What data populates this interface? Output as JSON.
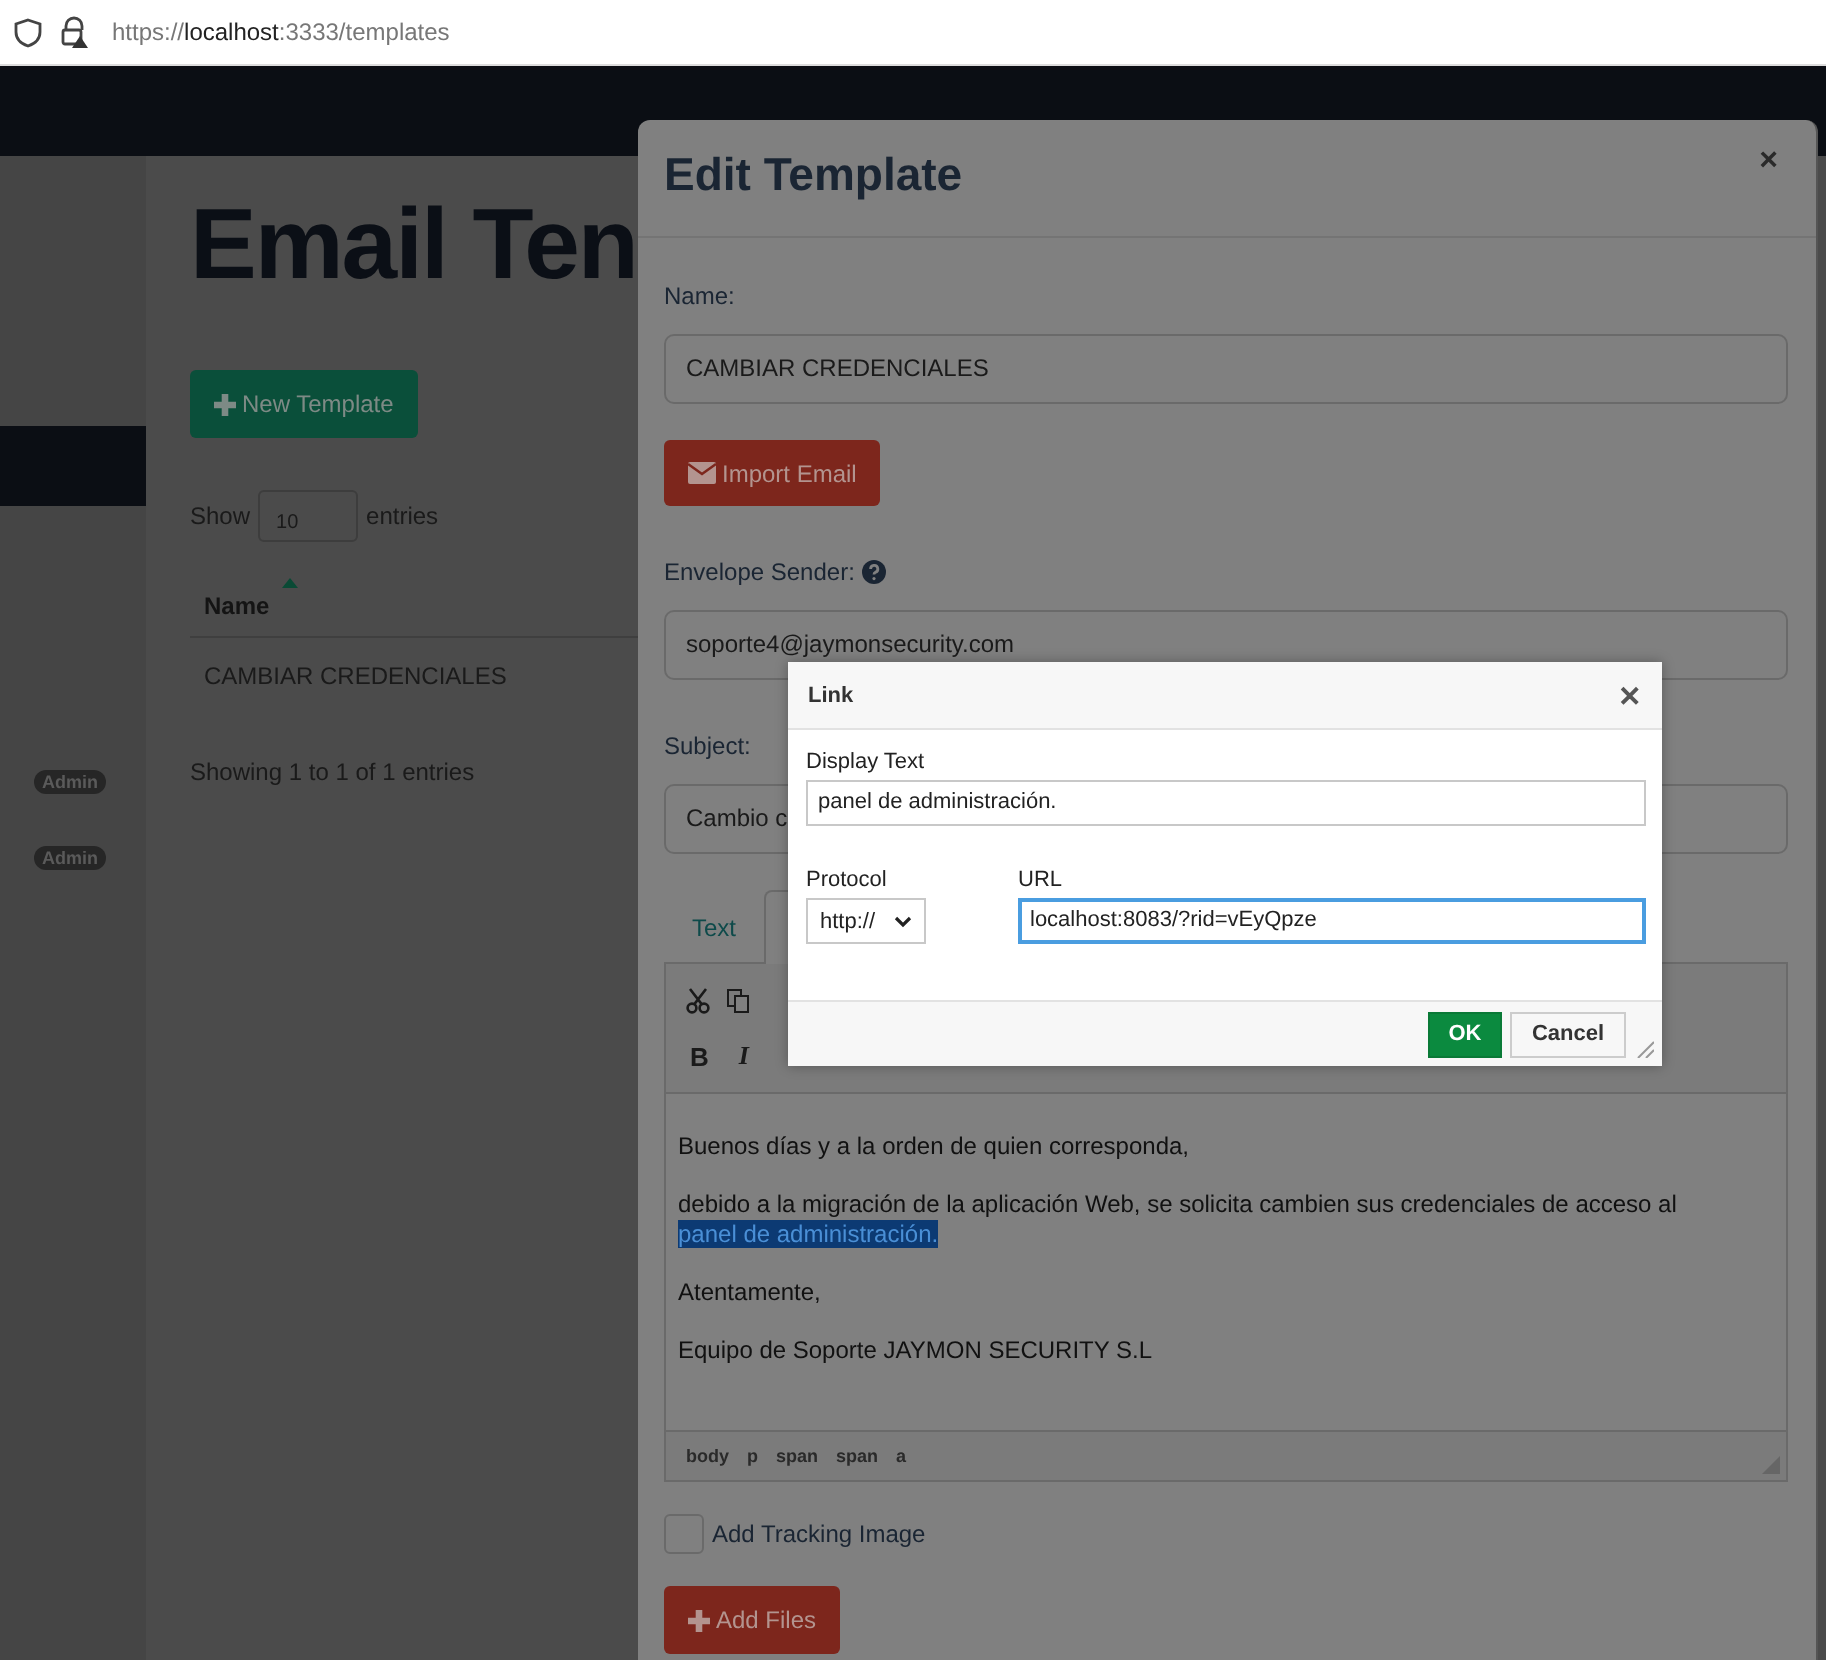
{
  "browser": {
    "url": "https://**localhost**:3333/templates"
  },
  "sidebar": {
    "items": [
      {
        "selected": true
      }
    ],
    "badges": [
      "Admin",
      "Admin"
    ]
  },
  "page": {
    "title": "Email Ten",
    "new_button": "New Template",
    "show_label": "Show",
    "entries_value": "10",
    "entries_label": "entries",
    "table": {
      "columns": [
        {
          "label": "Name",
          "sort_ascending": true
        }
      ],
      "rows": [
        [
          "CAMBIAR CREDENCIALES"
        ]
      ]
    },
    "info": "Showing 1 to 1 of 1 entries"
  },
  "modal": {
    "title": "Edit Template",
    "close": "×",
    "name_label": "Name:",
    "name_value": "CAMBIAR CREDENCIALES",
    "import_button": "Import Email",
    "sender_label": "Envelope Sender:",
    "sender_value": "soporte4@jaymonsecurity.com",
    "subject_label": "Subject:",
    "subject_value": "Cambio c",
    "tabs": [
      {
        "label": "Text",
        "selected": false
      },
      {
        "selected": true
      }
    ],
    "format_buttons": [
      "B",
      "I"
    ],
    "paragraphs": [
      {
        "text": "Buenos días y a la orden de quien corresponda,"
      },
      {
        "text": "debido a la migración de la aplicación Web, se solicita cambien sus credenciales de acceso al ",
        "link": "panel de administración.",
        "link_selected": true
      },
      {
        "text": "Atentamente,"
      },
      {
        "text": "Equipo de Soporte JAYMON SECURITY S.L"
      }
    ],
    "path": [
      "body",
      "p",
      "span",
      "span",
      "a"
    ],
    "tracking": {
      "label": "Add Tracking Image",
      "checked": false
    },
    "add_files": "Add Files"
  },
  "link_dialog": {
    "title": "Link",
    "close": "✕",
    "display_label": "Display Text",
    "display_value": "panel de administración.",
    "protocol_label": "Protocol",
    "protocol_value": "http://",
    "url_label": "URL",
    "url_value": "localhost:8083/?rid=vEyQpze",
    "ok": "OK",
    "cancel": "Cancel"
  }
}
